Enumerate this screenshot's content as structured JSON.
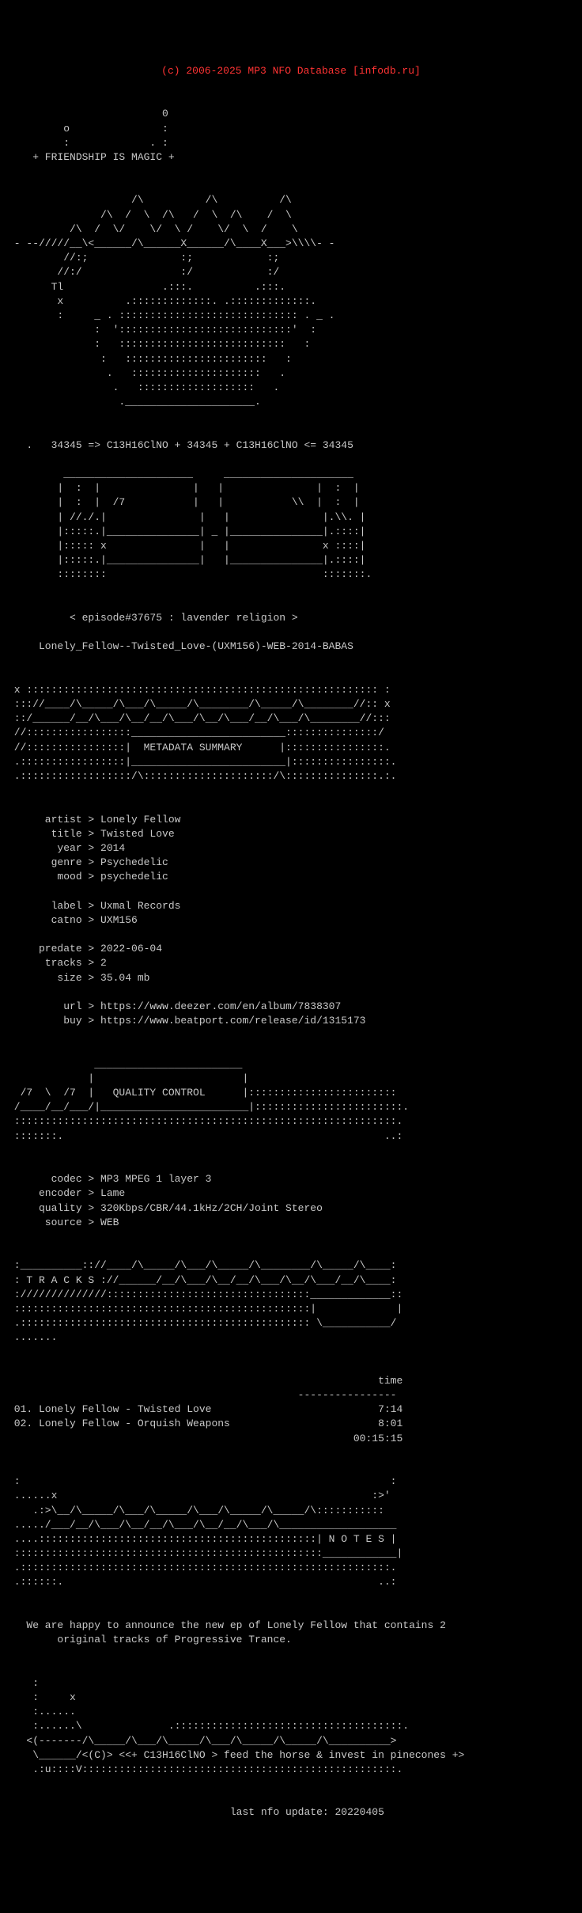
{
  "header": {
    "title": "(c) 2006-2025 MP3 NFO Database [infodb.ru]"
  },
  "ascii_art": {
    "full_text": "(c) 2006-2025 MP3 NFO Database [infodb.ru]\n\n                         0\n         o               :\n         :             . :\n    + FRIENDSHIP IS MAGIC +\n\n\n                    /\\          /\\          /\\\n               /\\  /  \\  /\\   /  \\  /\\    /  \\\n          /\\  /  \\/    \\/  \\ /    \\/  \\  /    \\\n - --/////__\\<______/\\______X______/\\____X___>\\\\\\\\- -\n         //:;               :;            :;\n        //:/                :/            :/\n       Tl                .:::.          .:::.\n        x          .:::::::::::::. .:::::::::::::.\n        :     _ . ::::::::::::::::::::::::::::: . _ .\n              :  '::::::::::::::::::::::::::::'  :\n              :   :::::::::::::::::::::::::::   :\n               :   :::::::::::::::::::::::   :\n                .   :::::::::::::::::::::   .\n                 .   :::::::::::::::::::   .\n                  ._____________________.  \n\n   .   34345 => C13H16ClNO + 34345 + C13H16ClNO <= 34345\n\n         _____________________     _____________________\n        |  :  |               |   |               |  :  |\n        |  :  |  /7           |   |           \\\\  |  :  |\n        | //./.|               |   |               |.\\\\. |\n        |:::::.|_______________| _ |_______________|.::::|\n        |::::: x               |   |               x ::::|\n        |:::::.|_______________|   |_______________|.::::|\n        ::::::::                                   :::::::.\n\n\n          < episode#37675 : lavender religion >\n\n     Lonely_Fellow--Twisted_Love-(UXM156)-WEB-2014-BABAS\n\n\n x ::::::::::::::::::::::::::::::::::::::::::::::::::::::::: :\n ::://____/\\_____/\\___/\\_____/\\________/\\_____/\\________//:: x\n ::/______/__/\\___/\\__/__/\\___/\\__/\\___/__/\\___/\\________//:::\n //:::::::::::::::::_________________________:::::::::::::::/\n //::::::::::::::::|  METADATA SUMMARY      |::::::::::::::::.\n .:::::::::::::::::|_________________________|::::::::::::::::.\n .::::::::::::::::::/\\:::::::::::::::::::::/\\:::::::::::::::.:.\n\n\n      artist > Lonely Fellow\n       title > Twisted Love\n        year > 2014\n       genre > Psychedelic\n        mood > psychedelic\n\n       label > Uxmal Records\n       catno > UXM156\n\n     predate > 2022-06-04\n      tracks > 2\n        size > 35.04 mb\n\n         url > https://www.deezer.com/en/album/7838307\n         buy > https://www.beatport.com/release/id/1315173\n\n\n              ________________________\n             |                        |\n  /7  \\  /7  |   QUALITY CONTROL      |::::::::::::::::::::::::\n /____/__/___/|________________________|:::::::::::::::::::::::.\n ::::::::::::::::::::::::::::::::::::::::::::::::::::::::::::::.\n :::::::.                                                    ..:\n\n\n       codec > MP3 MPEG 1 layer 3\n     encoder > Lame\n     quality > 320Kbps/CBR/44.1kHz/2CH/Joint Stereo\n      source > WEB\n\n\n :__________:://____/\\_____/\\___/\\_____/\\________/\\_____/\\____:\n : T R A C K S ://______/__/\\___/\\__/__/\\___/\\__/\\___/__/\\____:\n ://////////////:::::::::::::::::::::::::::::::::_____________::\n ::::::::::::::::::::::::::::::::::::::::::::::::|             |\n .::::::::::::::::::::::::::::::::::::::::::::::: \\___________/\n .......\n\n\n                                                            time\n                                               ----------------\n 01. Lonely Fellow - Twisted Love                           7:14\n 02. Lonely Fellow - Orquish Weapons                        8:01\n                                                        00:15:15\n\n\n :                                                            :\n ......x                                                   :>'\n    .:>\\__/\\_____/\\___/\\_____/\\___/\\_____/\\_____/\\:::::::::::\n ...../___/__/\\___/\\__/__/\\___/\\__/__/\\___/\\___________________\n ....:::::::::::::::::::::::::::::::::::::::::::::| N O T E S |\n ::::::::::::::::::::::::::::::::::::::::::::::::::____________|\n .::::::::::::::::::::::::::::::::::::::::::::::::::::::::::::.\n .::::::.                                                   ..:\n\n\n   We are happy to announce the new ep of Lonely Fellow that contains 2\n        original tracks of Progressive Trance.\n\n\n    :\n    :     x\n    :.....\n    :.....\\              .:::::::::::::::::::::::::::::::::::::.\n   <(-------/\\_____/\\___/\\_____/\\___/\\_____/\\_____/\\__________>\n    \\______/<(C)> <<+ C13H16ClNO > feed the horse & invest in pinecones +>\n    .:u::::V:::::::::::::::::::::::::::::::::::::::::::::::::::.\n\n\n                                    last nfo update: 20220405"
  }
}
